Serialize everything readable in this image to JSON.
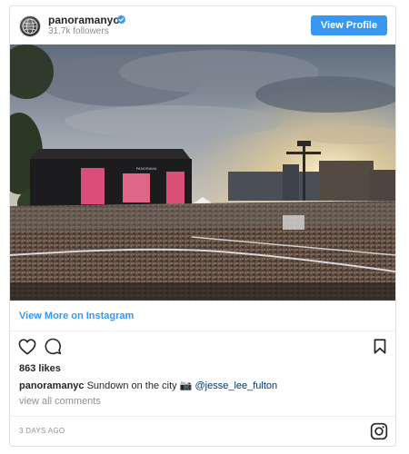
{
  "header": {
    "username": "panoramanyc",
    "followers": "31.7k followers",
    "view_profile_label": "View Profile",
    "avatar_icon": "globe-avatar-icon",
    "verified_icon": "verified-badge-icon"
  },
  "photo": {
    "stage_screen_text": "PANORAMA"
  },
  "view_more_label": "View More on Instagram",
  "actions": {
    "like_icon": "heart-icon",
    "comment_icon": "comment-icon",
    "save_icon": "bookmark-icon"
  },
  "likes": "863 likes",
  "caption": {
    "user": "panoramanyc",
    "text": " Sundown on the city ",
    "camera_glyph": "📷",
    "mention": "@jesse_lee_fulton"
  },
  "view_comments_label": "view all comments",
  "timestamp": "3 DAYS AGO",
  "footer_icon": "instagram-logo-icon",
  "colors": {
    "accent": "#3897f0",
    "text": "#262626",
    "muted": "#8e8e8e",
    "mention": "#003569"
  }
}
